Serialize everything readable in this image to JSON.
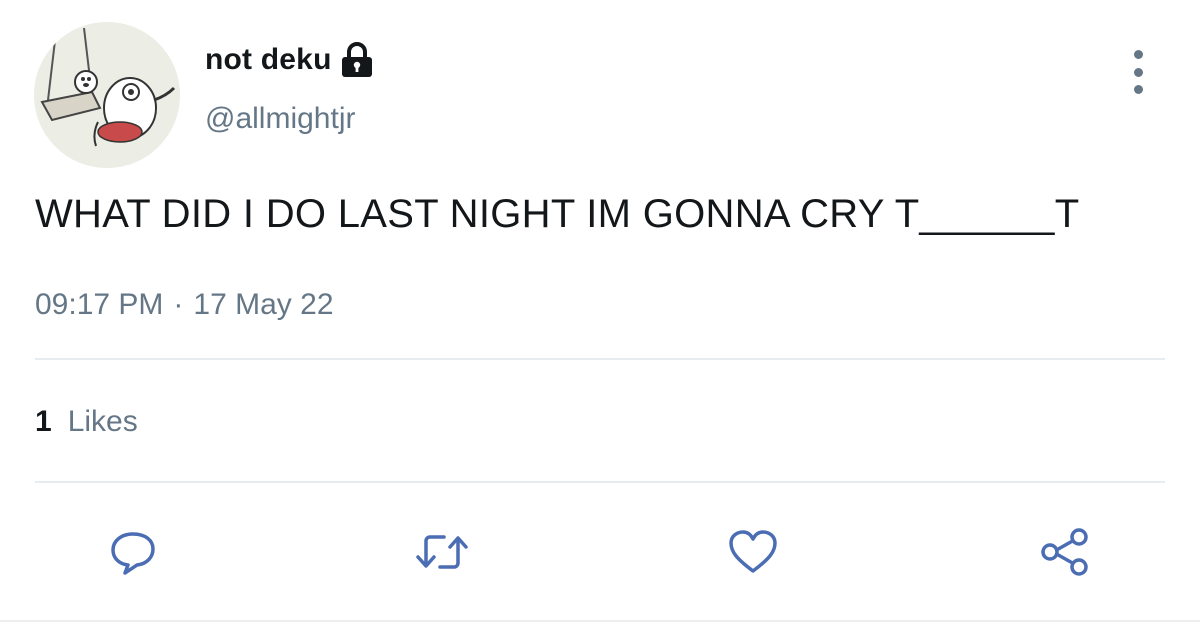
{
  "user": {
    "display_name": "not deku",
    "handle": "@allmightjr",
    "protected": true
  },
  "tweet": {
    "text": "WHAT DID I DO LAST NIGHT IM GONNA CRY T______T",
    "time": "09:17 PM",
    "separator": "·",
    "date": "17 May 22"
  },
  "stats": {
    "likes_count": "1",
    "likes_label": "Likes"
  },
  "actions": {
    "icons": [
      "reply-icon",
      "retweet-icon",
      "like-icon",
      "share-icon"
    ]
  },
  "colors": {
    "primary_text": "#14171a",
    "secondary_text": "#657786",
    "divider": "#e6ecf0",
    "icon_blue": "#4a6db4"
  }
}
